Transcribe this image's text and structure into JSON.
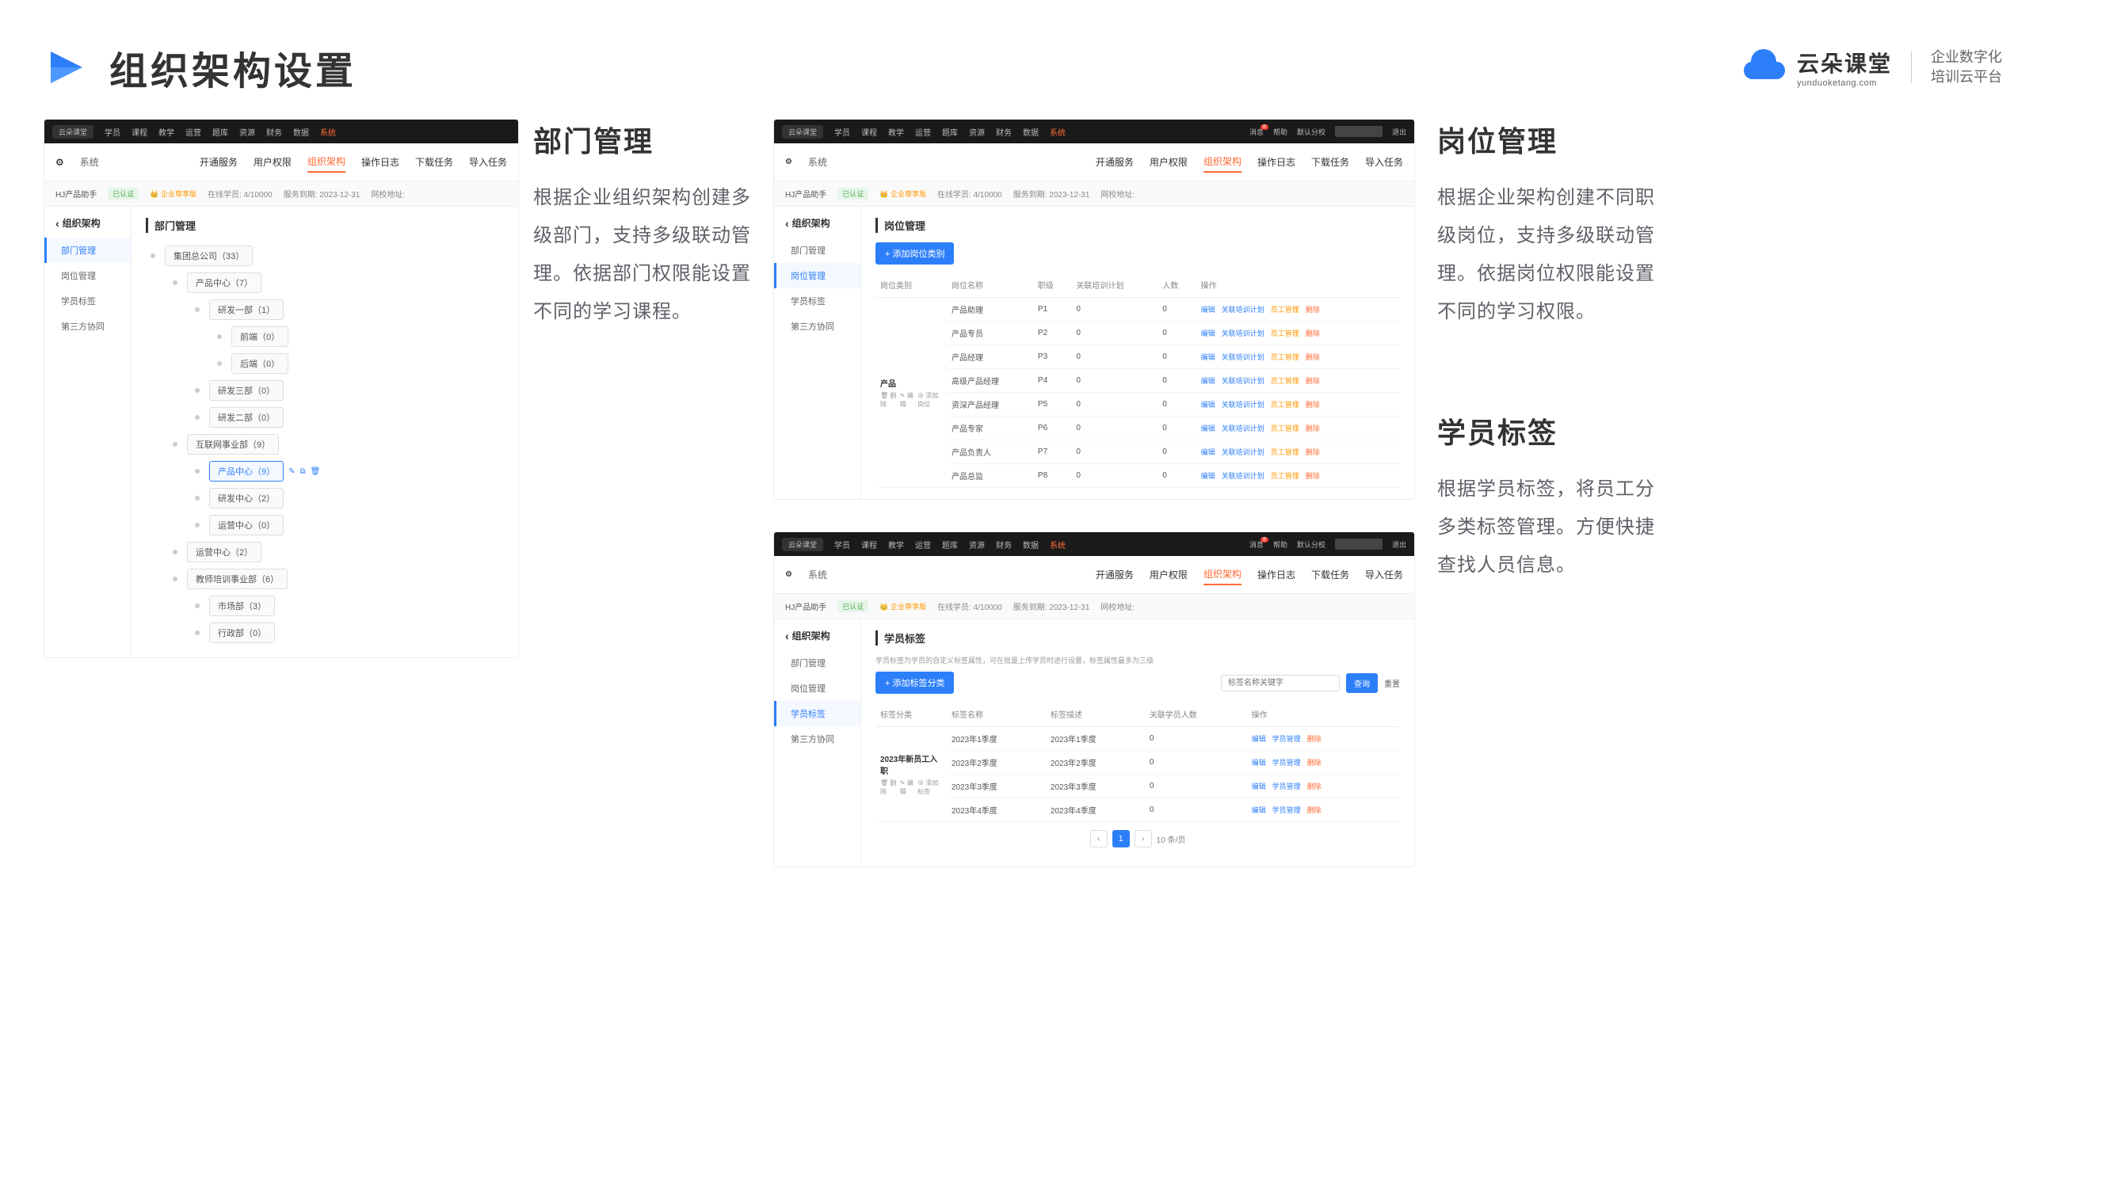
{
  "header": {
    "title": "组织架构设置",
    "brand_name": "云朵课堂",
    "brand_url": "yunduoketang.com",
    "brand_tagline1": "企业数字化",
    "brand_tagline2": "培训云平台"
  },
  "topbar": {
    "logo": "云朵课堂",
    "nav": [
      "学员",
      "课程",
      "教学",
      "运营",
      "题库",
      "资源",
      "财务",
      "数据"
    ],
    "nav_active": "系统",
    "msg": "消息",
    "msg_count": "8",
    "help": "帮助",
    "school": "默认分校",
    "exit": "退出"
  },
  "subnav": {
    "system": "系统",
    "tabs": [
      "开通服务",
      "用户权限",
      "组织架构",
      "操作日志",
      "下载任务",
      "导入任务"
    ],
    "active_tab": "组织架构"
  },
  "infostrip": {
    "org": "HJ产品助手",
    "cert": "已认证",
    "edition": "企业尊享版",
    "students": "在线学员: 4/10000",
    "expire": "服务到期: 2023-12-31",
    "url_label": "网校地址:"
  },
  "side": {
    "title": "组织架构",
    "items": [
      "部门管理",
      "岗位管理",
      "学员标签",
      "第三方协同"
    ]
  },
  "dept": {
    "main_title": "部门管理",
    "desc_title": "部门管理",
    "desc_text": "根据企业组织架构创建多级部门，支持多级联动管理。依据部门权限能设置不同的学习课程。",
    "tree": [
      {
        "label": "集团总公司（33）",
        "children": [
          {
            "label": "产品中心（7）",
            "children": [
              {
                "label": "研发一部（1）",
                "children": [
                  {
                    "label": "前端（0）"
                  },
                  {
                    "label": "后端（0）"
                  }
                ]
              },
              {
                "label": "研发三部（0）"
              },
              {
                "label": "研发二部（0）"
              }
            ]
          },
          {
            "label": "互联网事业部（9）",
            "children": [
              {
                "label": "产品中心（9）",
                "selected": true
              },
              {
                "label": "研发中心（2）"
              },
              {
                "label": "运营中心（0）"
              }
            ]
          },
          {
            "label": "运营中心（2）"
          },
          {
            "label": "教师培训事业部（6）",
            "children": [
              {
                "label": "市场部（3）"
              },
              {
                "label": "行政部（0）"
              }
            ]
          }
        ]
      }
    ]
  },
  "position": {
    "main_title": "岗位管理",
    "desc_title": "岗位管理",
    "desc_text": "根据企业架构创建不同职级岗位，支持多级联动管理。依据岗位权限能设置不同的学习权限。",
    "add_btn": "+ 添加岗位类别",
    "headers": [
      "岗位类别",
      "岗位名称",
      "职级",
      "关联培训计划",
      "人数",
      "操作"
    ],
    "category": "产品",
    "cat_del": "删除",
    "cat_edit": "编辑",
    "cat_add": "添加岗位",
    "rows": [
      {
        "name": "产品助理",
        "level": "P1",
        "plan": "0",
        "count": "0"
      },
      {
        "name": "产品专员",
        "level": "P2",
        "plan": "0",
        "count": "0"
      },
      {
        "name": "产品经理",
        "level": "P3",
        "plan": "0",
        "count": "0"
      },
      {
        "name": "高级产品经理",
        "level": "P4",
        "plan": "0",
        "count": "0"
      },
      {
        "name": "资深产品经理",
        "level": "P5",
        "plan": "0",
        "count": "0"
      },
      {
        "name": "产品专家",
        "level": "P6",
        "plan": "0",
        "count": "0"
      },
      {
        "name": "产品负责人",
        "level": "P7",
        "plan": "0",
        "count": "0"
      },
      {
        "name": "产品总监",
        "level": "P8",
        "plan": "0",
        "count": "0"
      }
    ],
    "op_edit": "编辑",
    "op_plan": "关联培训计划",
    "op_mgr": "员工管理",
    "op_del": "删除"
  },
  "tag": {
    "main_title": "学员标签",
    "desc_title": "学员标签",
    "desc_text": "根据学员标签，将员工分多类标签管理。方便快捷查找人员信息。",
    "hint": "学员标签为学员的自定义标签属性，可在批量上传学员时进行设置，标签属性最多为三级",
    "add_btn": "+ 添加标签分类",
    "search_ph": "标签名称关键字",
    "search_btn": "查询",
    "reset_btn": "重置",
    "headers": [
      "标签分类",
      "标签名称",
      "标签描述",
      "关联学员人数",
      "操作"
    ],
    "category": "2023年新员工入职",
    "cat_del": "删除",
    "cat_edit": "编辑",
    "cat_add": "添加标签",
    "rows": [
      {
        "name": "2023年1季度",
        "desc": "2023年1季度",
        "count": "0"
      },
      {
        "name": "2023年2季度",
        "desc": "2023年2季度",
        "count": "0"
      },
      {
        "name": "2023年3季度",
        "desc": "2023年3季度",
        "count": "0"
      },
      {
        "name": "2023年4季度",
        "desc": "2023年4季度",
        "count": "0"
      }
    ],
    "op_edit": "编辑",
    "op_mgr": "学员管理",
    "op_del": "删除",
    "page": "1",
    "page_size": "10 条/页"
  }
}
